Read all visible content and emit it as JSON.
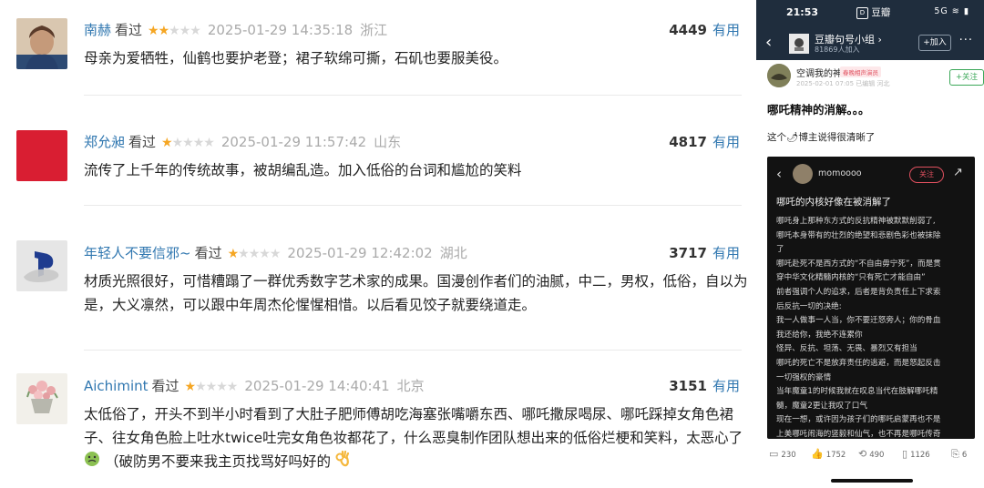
{
  "reviews": [
    {
      "user": "南赫",
      "action": "看过",
      "rating": 2,
      "time": "2025-01-29 14:35:18",
      "location": "浙江",
      "useful_count": "4449",
      "useful_label": "有用",
      "content": "母亲为爱牺牲，仙鹤也要护老登；裙子软绵可撕，石矶也要服美役。"
    },
    {
      "user": "郑允昶",
      "action": "看过",
      "rating": 1,
      "time": "2025-01-29 11:57:42",
      "location": "山东",
      "useful_count": "4817",
      "useful_label": "有用",
      "content": "流传了上千年的传统故事，被胡编乱造。加入低俗的台词和尴尬的笑料"
    },
    {
      "user": "年轻人不要信邪~",
      "action": "看过",
      "rating": 1,
      "time": "2025-01-29 12:42:02",
      "location": "湖北",
      "useful_count": "3717",
      "useful_label": "有用",
      "content_lines": [
        "材质光照很好，可惜糟蹋了一群优秀数字艺术家的成果。国漫创作者们的油腻，中二，男权，低俗，自以为",
        "是，大义凛然，可以跟中年周杰伦惺惺相惜。以后看见饺子就要绕道走。"
      ]
    },
    {
      "user": "Aichimint",
      "action": "看过",
      "rating": 1,
      "time": "2025-01-29 14:40:41",
      "location": "北京",
      "useful_count": "3151",
      "useful_label": "有用",
      "content_lines": [
        "太低俗了，开头不到半小时看到了大肚子肥师傅胡吃海塞张嘴嚼东西、哪吒撒尿喝尿、哪吒踩掉女角色裙",
        "子、往女角色脸上吐水twice吐完女角色妆都花了，什么恶臭制作团队想出来的低俗烂梗和笑料，太恶心了",
        "（破防男不要来我主页找骂好吗好的"
      ]
    }
  ],
  "phone": {
    "status_time": "21:53",
    "status_app": "豆瓣",
    "status_icons": "5G ≋ ▮",
    "group_name": "豆瓣句号小组 ›",
    "group_members": "81869人加入",
    "join_label": "+加入",
    "more": "···",
    "author_name": "空调我的神",
    "author_tag": "春晚相声演员",
    "author_sub": "2025-02-01 07:05  已编辑  河北",
    "follow_label": "+关注",
    "post_title": "哪吒精神的消解。。。",
    "post_body": "这个🌶博主说得很清晰了",
    "embed_user": "momoooo",
    "embed_follow": "关注",
    "embed_title": "哪吒的内核好像在被消解了",
    "embed_lines": [
      "哪吒身上那种东方式的反抗精神被默默削弱了,",
      "哪吒本身带有的壮烈的绝望和悲剧色彩也被抹除",
      "了",
      "哪吒赴死不是西方式的“不自由毋宁死”，而是贯",
      "穿中华文化精髓内核的“只有死亡才能自由”",
      "前者强调个人的追求，后者是背负责任上下求索",
      "后反抗一切的决绝:",
      "我一人做事一人当，你不要迁怒旁人；你的骨血",
      "我还给你，我绝不连累你",
      "怪异、反抗、坦荡、无畏、暴烈又有担当",
      "哪吒的死亡不是放弃责任的逃避，而是怒起反击",
      "一切强权的豪情",
      "当年魔童1的时候我就在叹息当代在肢解哪吒精",
      "髓，魔童2更让我叹了口气",
      "现在一想，或许因为孩子们的哪吒启蒙再也不是",
      "上美哪吒闹海的竖毅和仙气，也不再是哪吒传奇"
    ],
    "actions": {
      "comments": "230",
      "likes": "1752",
      "reposts": "490",
      "collects": "1126",
      "shares": "6"
    }
  }
}
